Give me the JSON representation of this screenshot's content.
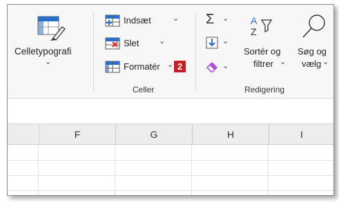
{
  "ribbon": {
    "cellstyles": {
      "label": "Celletypografi",
      "chev": "⌄"
    },
    "cells": {
      "group_label": "Celler",
      "insert": {
        "label": "Indsæt",
        "chev": "⌄"
      },
      "delete": {
        "label": "Slet",
        "chev": "⌄"
      },
      "format": {
        "label": "Formatér",
        "chev": "⌄",
        "badge": "2"
      }
    },
    "editing": {
      "group_label": "Redigering",
      "sum": {
        "glyph": "Σ",
        "chev": "⌄"
      },
      "fill": {
        "chev": "⌄"
      },
      "clear": {
        "chev": "⌄"
      },
      "sort": {
        "label1": "Sortér og",
        "label2": "filtrer",
        "chev": "⌄"
      },
      "find": {
        "label1": "Søg og",
        "label2": "vælg",
        "chev": "⌄"
      }
    }
  },
  "columns": [
    "F",
    "G",
    "H",
    "I"
  ],
  "colors": {
    "accent_blue": "#2b6fc8",
    "badge_red": "#c0202a",
    "eraser_purple": "#b14fd6"
  }
}
